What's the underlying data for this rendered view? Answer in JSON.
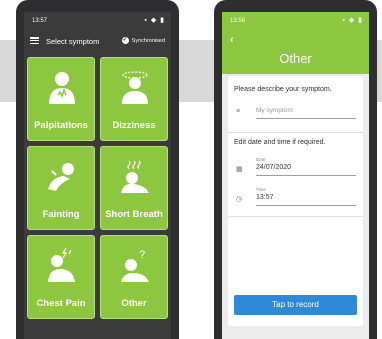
{
  "left_screen": {
    "status": {
      "time": "13:57"
    },
    "toolbar": {
      "title": "Select symptom",
      "sync_label": "Synchronised"
    },
    "tiles": [
      {
        "label": "Palpitations",
        "icon": "palpitations-icon"
      },
      {
        "label": "Dizziness",
        "icon": "dizziness-icon"
      },
      {
        "label": "Fainting",
        "icon": "fainting-icon"
      },
      {
        "label": "Short Breath",
        "icon": "short-breath-icon"
      },
      {
        "label": "Chest Pain",
        "icon": "chest-pain-icon"
      },
      {
        "label": "Other",
        "icon": "other-symptom-icon"
      }
    ]
  },
  "right_screen": {
    "status": {
      "time": "13:58"
    },
    "title": "Other",
    "prompt_symptom": "Please describe your symptom.",
    "symptom_placeholder": "My symptom",
    "prompt_datetime": "Edit date and time if required.",
    "date_label": "Date",
    "date_value": "24/07/2020",
    "time_label": "Time",
    "time_value": "13:57",
    "record_button": "Tap to record"
  },
  "colors": {
    "accent_green": "#8dc63f",
    "dark_bg": "#3b3b3c",
    "button_blue": "#2d8ad8"
  }
}
